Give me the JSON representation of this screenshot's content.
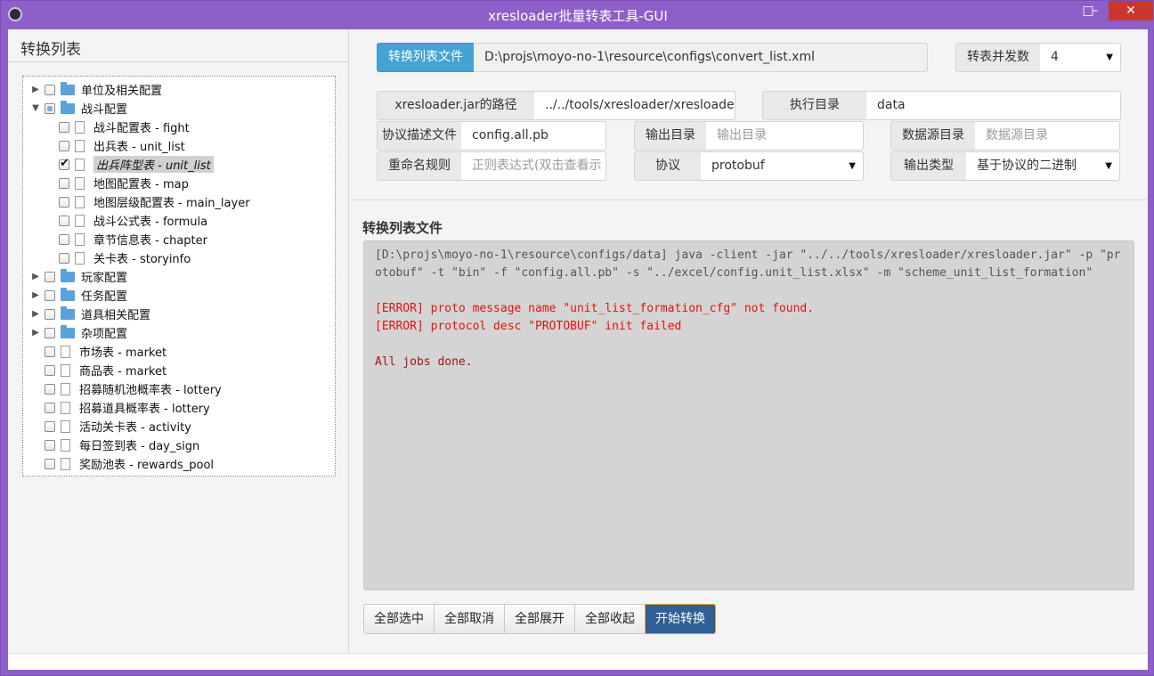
{
  "window": {
    "title": "xresloader批量转表工具-GUI",
    "min_glyph": "–",
    "max_glyph": "□",
    "close_glyph": "✕"
  },
  "left": {
    "title": "转换列表",
    "tree": [
      {
        "label": "单位及相关配置",
        "type": "folder",
        "expanded": false,
        "check": "none",
        "level": 0
      },
      {
        "label": "战斗配置",
        "type": "folder",
        "expanded": true,
        "check": "partial",
        "level": 0
      },
      {
        "label": "战斗配置表 - fight",
        "type": "file",
        "check": "none",
        "level": 1
      },
      {
        "label": "出兵表 - unit_list",
        "type": "file",
        "check": "none",
        "level": 1
      },
      {
        "label": "出兵阵型表 - unit_list",
        "type": "file",
        "check": "checked",
        "level": 1,
        "selected": true
      },
      {
        "label": "地图配置表 - map",
        "type": "file",
        "check": "none",
        "level": 1
      },
      {
        "label": "地图层级配置表 - main_layer",
        "type": "file",
        "check": "none",
        "level": 1
      },
      {
        "label": "战斗公式表 - formula",
        "type": "file",
        "check": "none",
        "level": 1
      },
      {
        "label": "章节信息表 - chapter",
        "type": "file",
        "check": "none",
        "level": 1
      },
      {
        "label": "关卡表 - storyinfo",
        "type": "file",
        "check": "none",
        "level": 1
      },
      {
        "label": "玩家配置",
        "type": "folder",
        "expanded": false,
        "check": "none",
        "level": 0
      },
      {
        "label": "任务配置",
        "type": "folder",
        "expanded": false,
        "check": "none",
        "level": 0
      },
      {
        "label": "道具相关配置",
        "type": "folder",
        "expanded": false,
        "check": "none",
        "level": 0
      },
      {
        "label": "杂项配置",
        "type": "folder",
        "expanded": false,
        "check": "none",
        "level": 0
      },
      {
        "label": "市场表 - market",
        "type": "file",
        "check": "none",
        "level": 0
      },
      {
        "label": "商品表 - market",
        "type": "file",
        "check": "none",
        "level": 0
      },
      {
        "label": "招募随机池概率表 - lottery",
        "type": "file",
        "check": "none",
        "level": 0
      },
      {
        "label": "招募道具概率表 - lottery",
        "type": "file",
        "check": "none",
        "level": 0
      },
      {
        "label": "活动关卡表 - activity",
        "type": "file",
        "check": "none",
        "level": 0
      },
      {
        "label": "每日签到表 - day_sign",
        "type": "file",
        "check": "none",
        "level": 0
      },
      {
        "label": "奖励池表 - rewards_pool",
        "type": "file",
        "check": "none",
        "level": 0
      }
    ]
  },
  "config": {
    "convert_list_label": "转换列表文件",
    "convert_list_value": "D:\\projs\\moyo-no-1\\resource\\configs\\convert_list.xml",
    "concurrency_label": "转表并发数",
    "concurrency_value": "4",
    "jar_label": "xresloader.jar的路径",
    "jar_value": "../../tools/xresloader/xresloader.",
    "workdir_label": "执行目录",
    "workdir_value": "data",
    "proto_desc_label": "协议描述文件",
    "proto_desc_value": "config.all.pb",
    "output_dir_label": "输出目录",
    "output_dir_placeholder": "输出目录",
    "datasource_label": "数据源目录",
    "datasource_placeholder": "数据源目录",
    "rename_label": "重命名规则",
    "rename_placeholder": "正则表达式(双击查看示",
    "protocol_label": "协议",
    "protocol_value": "protobuf",
    "output_type_label": "输出类型",
    "output_type_value": "基于协议的二进制"
  },
  "log": {
    "title": "转换列表文件",
    "command": "[D:\\projs\\moyo-no-1\\resource\\configs/data] java -client -jar \"../../tools/xresloader/xresloader.jar\" -p \"protobuf\" -t \"bin\" -f \"config.all.pb\" -s \"../excel/config.unit_list.xlsx\" -m \"scheme_unit_list_formation\"",
    "error1": "[ERROR] proto message name \"unit_list_formation_cfg\" not found.",
    "error2": "[ERROR] protocol desc \"PROTOBUF\" init failed",
    "done": "All jobs done."
  },
  "buttons": {
    "select_all": "全部选中",
    "deselect_all": "全部取消",
    "expand_all": "全部展开",
    "collapse_all": "全部收起",
    "start": "开始转换"
  },
  "colors": {
    "title_bar": "#8e5fc8",
    "accent": "#45a3d4",
    "primary_button": "#2f5f94",
    "error": "#e8100e"
  }
}
